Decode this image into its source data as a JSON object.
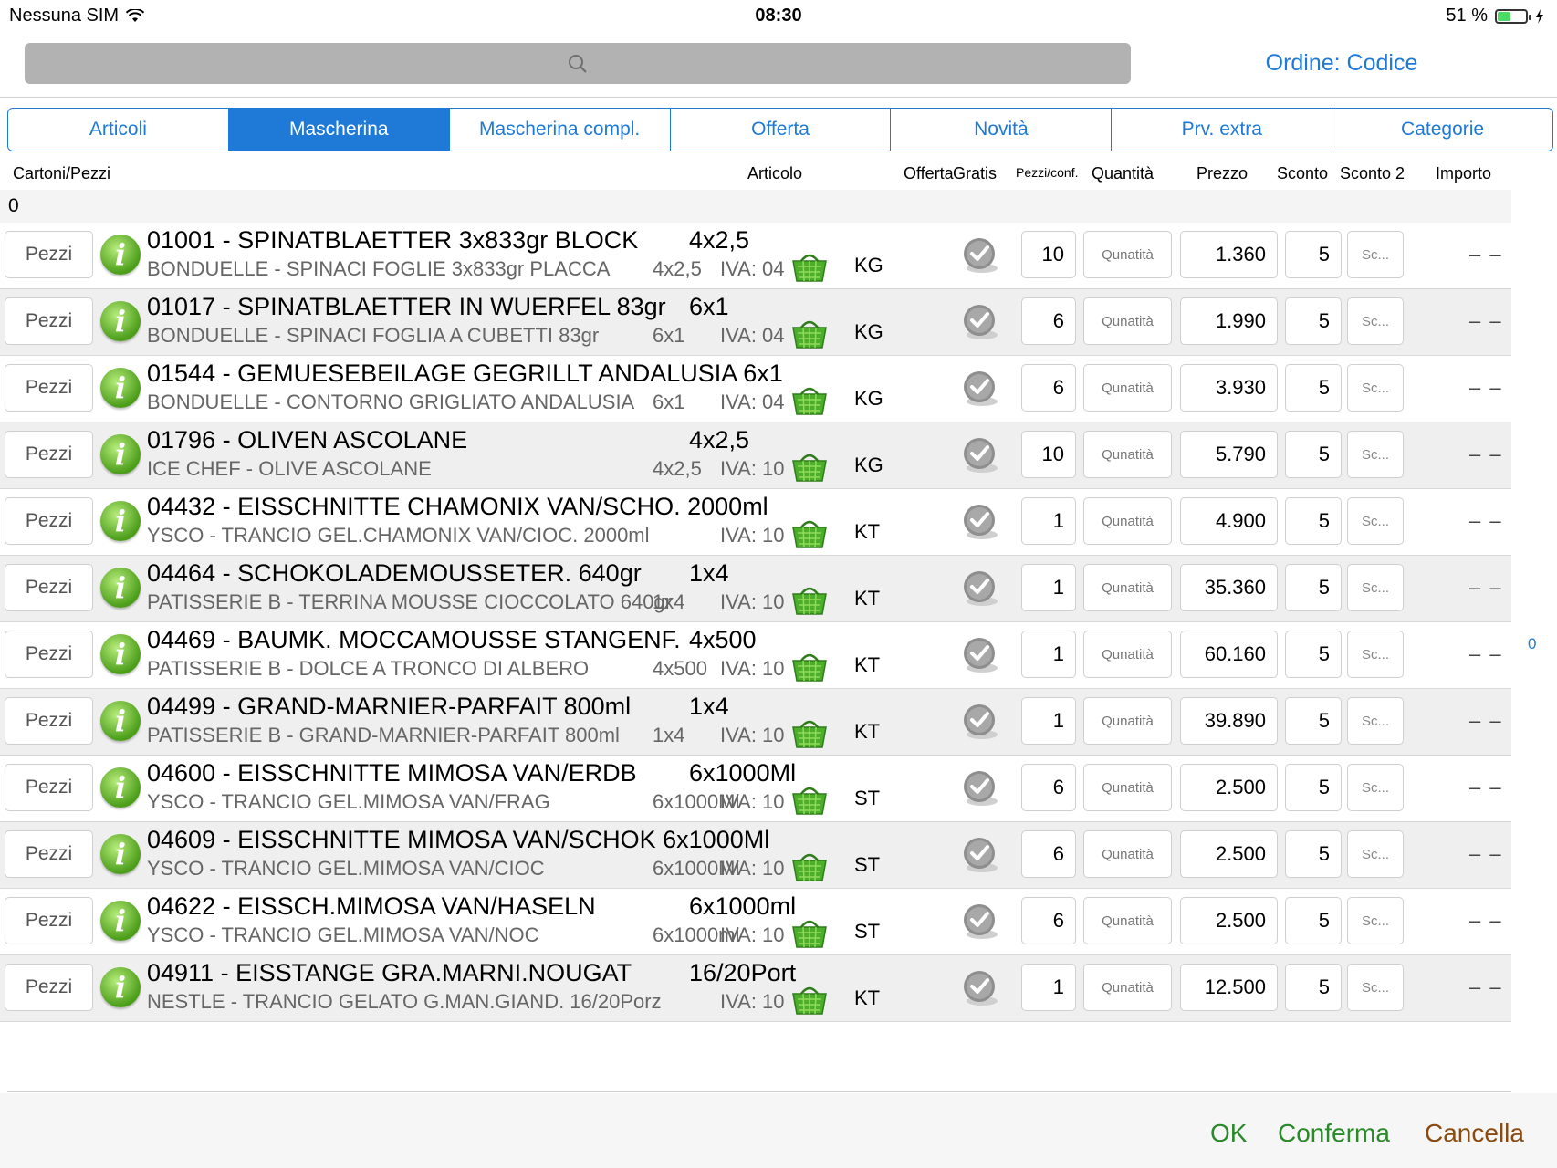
{
  "status_bar": {
    "carrier": "Nessuna SIM",
    "time": "08:30",
    "battery": "51 %",
    "battery_level": 0.51
  },
  "search": {
    "placeholder": ""
  },
  "order_label": "Ordine: Codice",
  "tabs": [
    {
      "label": "Articoli",
      "active": false
    },
    {
      "label": "Mascherina",
      "active": true
    },
    {
      "label": "Mascherina compl.",
      "active": false
    },
    {
      "label": "Offerta",
      "active": false
    },
    {
      "label": "Novità",
      "active": false
    },
    {
      "label": "Prv. extra",
      "active": false
    },
    {
      "label": "Categorie",
      "active": false
    }
  ],
  "headers": {
    "cartoni": "Cartoni/Pezzi",
    "articolo": "Articolo",
    "offerta": "Offerta",
    "gratis": "Gratis",
    "pezzi_conf": "Pezzi/conf.",
    "quantita": "Quantità",
    "prezzo": "Prezzo",
    "sconto": "Sconto",
    "sconto2": "Sconto 2",
    "importo": "Importo"
  },
  "group_value": "0",
  "side_value": "0",
  "rows": [
    {
      "button": "Pezzi",
      "code_name": "01001 - SPINATBLAETTER 3x833gr BLOCK",
      "pack": "4x2,5",
      "desc": "BONDUELLE - SPINACI FOGLIE 3x833gr PLACCA",
      "sub_pack": "4x2,5",
      "iva": "IVA: 04",
      "unit": "KG",
      "pezzi": "10",
      "qty_placeholder": "Qunatità",
      "price": "1.360",
      "sconto": "5",
      "sconto2_placeholder": "Sc...",
      "importo": "– –"
    },
    {
      "button": "Pezzi",
      "code_name": "01017 - SPINATBLAETTER IN WUERFEL 83gr",
      "pack": "6x1",
      "desc": "BONDUELLE - SPINACI FOGLIA A CUBETTI 83gr",
      "sub_pack": "6x1",
      "iva": "IVA: 04",
      "unit": "KG",
      "pezzi": "6",
      "qty_placeholder": "Qunatità",
      "price": "1.990",
      "sconto": "5",
      "sconto2_placeholder": "Sc...",
      "importo": "– –"
    },
    {
      "button": "Pezzi",
      "code_name": "01544 - GEMUESEBEILAGE GEGRILLT ANDALUSIA 6x1",
      "pack": "",
      "desc": "BONDUELLE - CONTORNO GRIGLIATO ANDALUSIA",
      "sub_pack": "6x1",
      "iva": "IVA: 04",
      "unit": "KG",
      "pezzi": "6",
      "qty_placeholder": "Qunatità",
      "price": "3.930",
      "sconto": "5",
      "sconto2_placeholder": "Sc...",
      "importo": "– –"
    },
    {
      "button": "Pezzi",
      "code_name": "01796 - OLIVEN ASCOLANE",
      "pack": "4x2,5",
      "desc": "ICE CHEF - OLIVE ASCOLANE",
      "sub_pack": "4x2,5",
      "iva": "IVA: 10",
      "unit": "KG",
      "pezzi": "10",
      "qty_placeholder": "Qunatità",
      "price": "5.790",
      "sconto": "5",
      "sconto2_placeholder": "Sc...",
      "importo": "– –"
    },
    {
      "button": "Pezzi",
      "code_name": "04432 - EISSCHNITTE CHAMONIX VAN/SCHO. 2000ml",
      "pack": "",
      "desc": "YSCO - TRANCIO GEL.CHAMONIX VAN/CIOC. 2000ml",
      "sub_pack": "",
      "iva": "IVA: 10",
      "unit": "KT",
      "pezzi": "1",
      "qty_placeholder": "Qunatità",
      "price": "4.900",
      "sconto": "5",
      "sconto2_placeholder": "Sc...",
      "importo": "– –"
    },
    {
      "button": "Pezzi",
      "code_name": "04464 - SCHOKOLADEMOUSSETER. 640gr",
      "pack": "1x4",
      "desc": "PATISSERIE B - TERRINA MOUSSE CIOCCOLATO 640gr",
      "sub_pack": "1x4",
      "iva": "IVA: 10",
      "unit": "KT",
      "pezzi": "1",
      "qty_placeholder": "Qunatità",
      "price": "35.360",
      "sconto": "5",
      "sconto2_placeholder": "Sc...",
      "importo": "– –"
    },
    {
      "button": "Pezzi",
      "code_name": "04469 - BAUMK. MOCCAMOUSSE STANGENF.",
      "pack": "4x500",
      "desc": "PATISSERIE B - DOLCE A TRONCO DI ALBERO",
      "sub_pack": "4x500",
      "iva": "IVA: 10",
      "unit": "KT",
      "pezzi": "1",
      "qty_placeholder": "Qunatità",
      "price": "60.160",
      "sconto": "5",
      "sconto2_placeholder": "Sc...",
      "importo": "– –"
    },
    {
      "button": "Pezzi",
      "code_name": "04499 - GRAND-MARNIER-PARFAIT 800ml",
      "pack": "1x4",
      "desc": "PATISSERIE B - GRAND-MARNIER-PARFAIT 800ml",
      "sub_pack": "1x4",
      "iva": "IVA: 10",
      "unit": "KT",
      "pezzi": "1",
      "qty_placeholder": "Qunatità",
      "price": "39.890",
      "sconto": "5",
      "sconto2_placeholder": "Sc...",
      "importo": "– –"
    },
    {
      "button": "Pezzi",
      "code_name": "04600 - EISSCHNITTE MIMOSA VAN/ERDB",
      "pack": "6x1000Ml",
      "desc": "YSCO - TRANCIO GEL.MIMOSA VAN/FRAG",
      "sub_pack": "6x1000Ml",
      "iva": "IVA: 10",
      "unit": "ST",
      "pezzi": "6",
      "qty_placeholder": "Qunatità",
      "price": "2.500",
      "sconto": "5",
      "sconto2_placeholder": "Sc...",
      "importo": "– –"
    },
    {
      "button": "Pezzi",
      "code_name": "04609 - EISSCHNITTE MIMOSA VAN/SCHOK 6x1000Ml",
      "pack": "",
      "desc": "YSCO - TRANCIO GEL.MIMOSA VAN/CIOC",
      "sub_pack": "6x1000Ml",
      "iva": "IVA: 10",
      "unit": "ST",
      "pezzi": "6",
      "qty_placeholder": "Qunatità",
      "price": "2.500",
      "sconto": "5",
      "sconto2_placeholder": "Sc...",
      "importo": "– –"
    },
    {
      "button": "Pezzi",
      "code_name": "04622 - EISSCH.MIMOSA VAN/HASELN",
      "pack": "6x1000ml",
      "desc": "YSCO - TRANCIO GEL.MIMOSA VAN/NOC",
      "sub_pack": "6x1000ml",
      "iva": "IVA: 10",
      "unit": "ST",
      "pezzi": "6",
      "qty_placeholder": "Qunatità",
      "price": "2.500",
      "sconto": "5",
      "sconto2_placeholder": "Sc...",
      "importo": "– –"
    },
    {
      "button": "Pezzi",
      "code_name": "04911 - EISSTANGE GRA.MARNI.NOUGAT",
      "pack": "16/20Port",
      "desc": "NESTLE - TRANCIO GELATO G.MAN.GIAND. 16/20Porz",
      "sub_pack": "",
      "iva": "IVA: 10",
      "unit": "KT",
      "pezzi": "1",
      "qty_placeholder": "Qunatità",
      "price": "12.500",
      "sconto": "5",
      "sconto2_placeholder": "Sc...",
      "importo": "– –"
    }
  ],
  "footer": {
    "ok": "OK",
    "conferma": "Conferma",
    "cancella": "Cancella"
  },
  "colors": {
    "accent": "#1e7ad6",
    "ok": "#2a8a2a",
    "cancel": "#8a4a10",
    "info_icon": "#5aa922",
    "basket_icon": "#4cae2b"
  }
}
